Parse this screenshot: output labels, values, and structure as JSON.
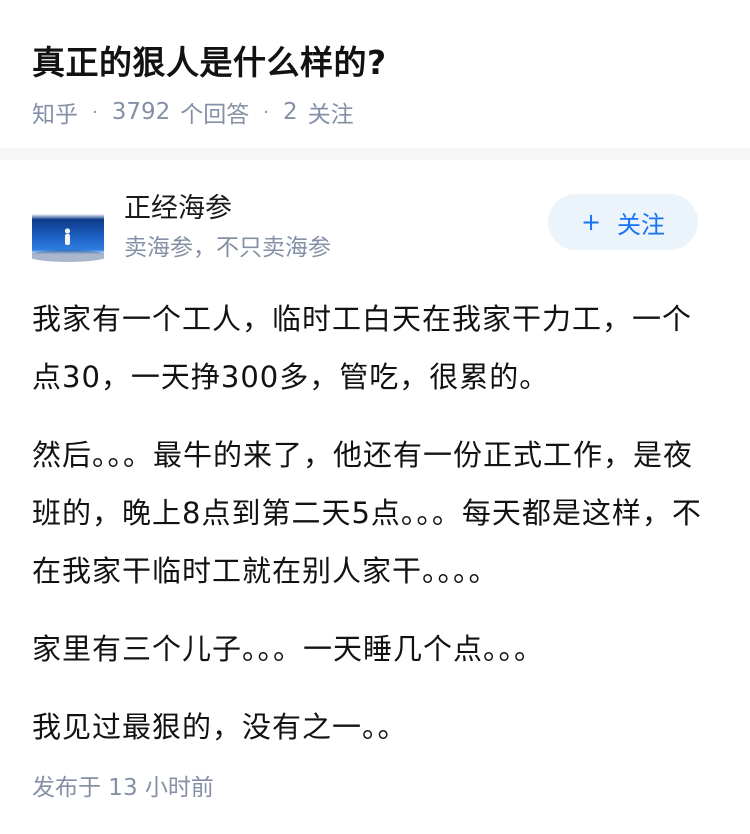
{
  "question": {
    "title": "真正的狠人是什么样的?",
    "source": "知乎",
    "answer_count": "3792",
    "answer_label": "个回答",
    "follow_count": "2",
    "follow_label": "关注"
  },
  "answer": {
    "author": {
      "name": "正经海参",
      "bio": "卖海参，不只卖海参",
      "avatar_icon": "avatar-icon"
    },
    "follow_button": {
      "plus": "+",
      "label": "关注"
    },
    "paragraphs": [
      "我家有一个工人，临时工白天在我家干力工，一个点30，一天挣300多，管吃，很累的。",
      "然后。。。最牛的来了，他还有一份正式工作，是夜班的，晚上8点到第二天5点。。。每天都是这样，不在我家干临时工就在别人家干。。。。",
      "家里有三个儿子。。。一天睡几个点。。。",
      "我见过最狠的，没有之一。。"
    ],
    "published": "发布于 13 小时前"
  },
  "colors": {
    "accent": "#1772f6",
    "meta": "#8590a6",
    "follow_bg": "#ebf3fb"
  }
}
